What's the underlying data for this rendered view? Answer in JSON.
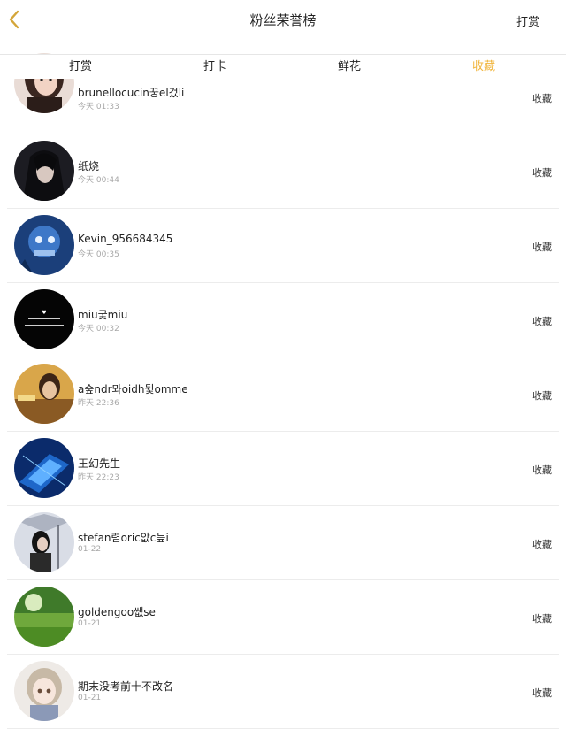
{
  "header": {
    "title": "粉丝荣誉榜",
    "action_label": "打赏",
    "back_icon": "chevron-left-icon",
    "accent_color": "#f0b43a"
  },
  "tabs": [
    {
      "label": "打赏",
      "active": false
    },
    {
      "label": "打卡",
      "active": false
    },
    {
      "label": "鲜花",
      "active": false
    },
    {
      "label": "收藏",
      "active": true
    }
  ],
  "list": {
    "items": [
      {
        "name": "brunellocucin꿍el겄li",
        "time": "今天 01:33",
        "action": "收藏"
      },
      {
        "name": "纸烧",
        "time": "今天 00:44",
        "action": "收藏"
      },
      {
        "name": "Kevin_956684345",
        "time": "今天 00:35",
        "action": "收藏"
      },
      {
        "name": "miu궃miu",
        "time": "今天 00:32",
        "action": "收藏"
      },
      {
        "name": "a숲ndr뫄oidh뒻omme",
        "time": "昨天 22:36",
        "action": "收藏"
      },
      {
        "name": "王幻先生",
        "time": "昨天 22:23",
        "action": "收藏"
      },
      {
        "name": "stefan렴oric앖c늪i",
        "time": "01-22",
        "action": "收藏"
      },
      {
        "name": "goldengoo쌦se",
        "time": "01-21",
        "action": "收藏"
      },
      {
        "name": "期末没考前十不改名",
        "time": "01-21",
        "action": "收藏"
      }
    ]
  }
}
